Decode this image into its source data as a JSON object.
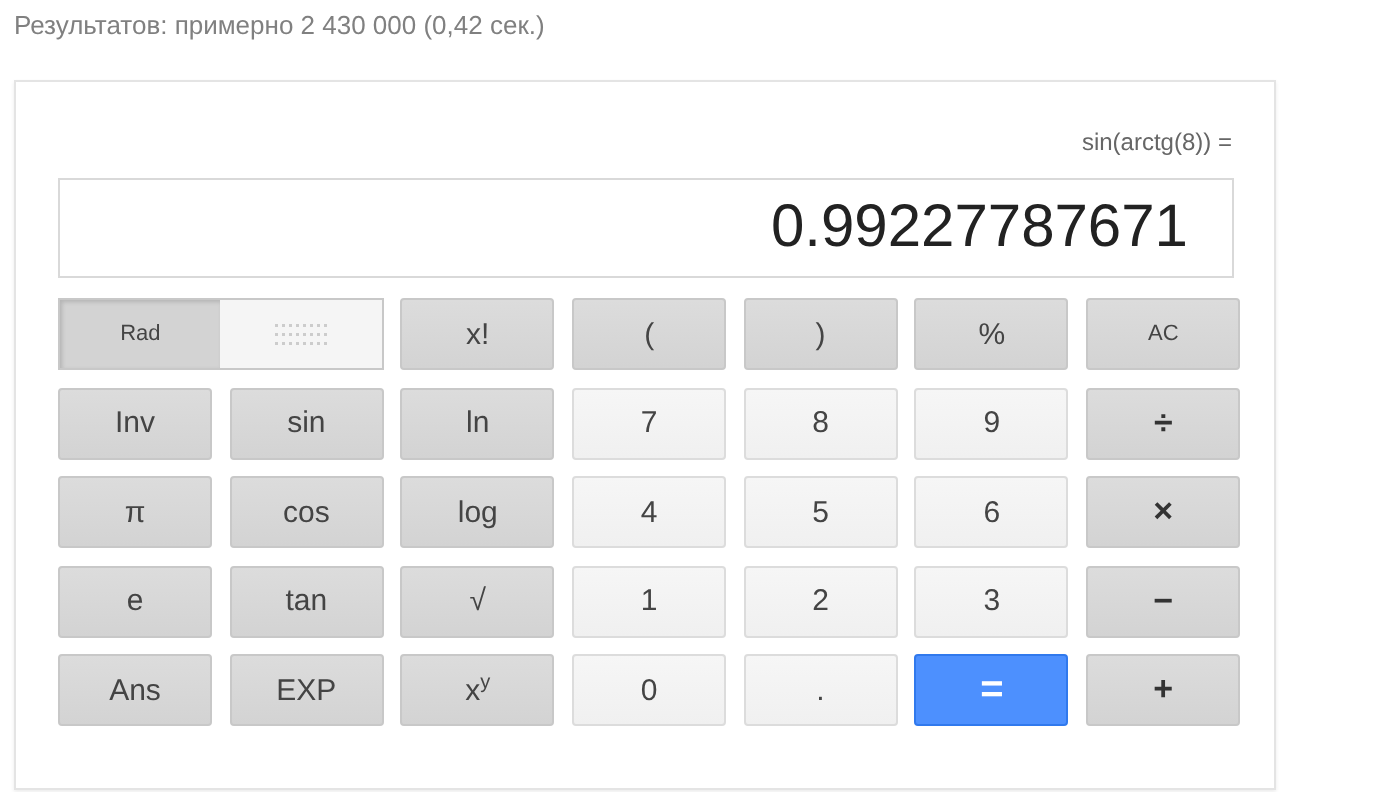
{
  "results_stats": "Результатов: примерно 2 430 000 (0,42 сек.)",
  "calculator": {
    "expression": "sin(arctg(8)) =",
    "display": "0.99227787671",
    "angle_mode": {
      "label": "Rad",
      "selected": true
    },
    "keys": [
      {
        "label": "x!",
        "kind": "func"
      },
      {
        "label": "(",
        "kind": "func"
      },
      {
        "label": ")",
        "kind": "func"
      },
      {
        "label": "%",
        "kind": "func"
      },
      {
        "label": "AC",
        "kind": "func"
      },
      {
        "label": "Inv",
        "kind": "func"
      },
      {
        "label": "sin",
        "kind": "func"
      },
      {
        "label": "ln",
        "kind": "func"
      },
      {
        "label": "7",
        "kind": "digit"
      },
      {
        "label": "8",
        "kind": "digit"
      },
      {
        "label": "9",
        "kind": "digit"
      },
      {
        "label": "÷",
        "kind": "op"
      },
      {
        "label": "π",
        "kind": "func"
      },
      {
        "label": "cos",
        "kind": "func"
      },
      {
        "label": "log",
        "kind": "func"
      },
      {
        "label": "4",
        "kind": "digit"
      },
      {
        "label": "5",
        "kind": "digit"
      },
      {
        "label": "6",
        "kind": "digit"
      },
      {
        "label": "×",
        "kind": "op"
      },
      {
        "label": "e",
        "kind": "func"
      },
      {
        "label": "tan",
        "kind": "func"
      },
      {
        "label": "√",
        "kind": "func"
      },
      {
        "label": "1",
        "kind": "digit"
      },
      {
        "label": "2",
        "kind": "digit"
      },
      {
        "label": "3",
        "kind": "digit"
      },
      {
        "label": "−",
        "kind": "op"
      },
      {
        "label": "Ans",
        "kind": "func"
      },
      {
        "label": "EXP",
        "kind": "func"
      },
      {
        "label": "x$^{y}$",
        "kind": "func"
      },
      {
        "label": "0",
        "kind": "digit"
      },
      {
        "label": ".",
        "kind": "digit"
      },
      {
        "label": "=",
        "kind": "equals"
      },
      {
        "label": "+",
        "kind": "op"
      }
    ]
  }
}
